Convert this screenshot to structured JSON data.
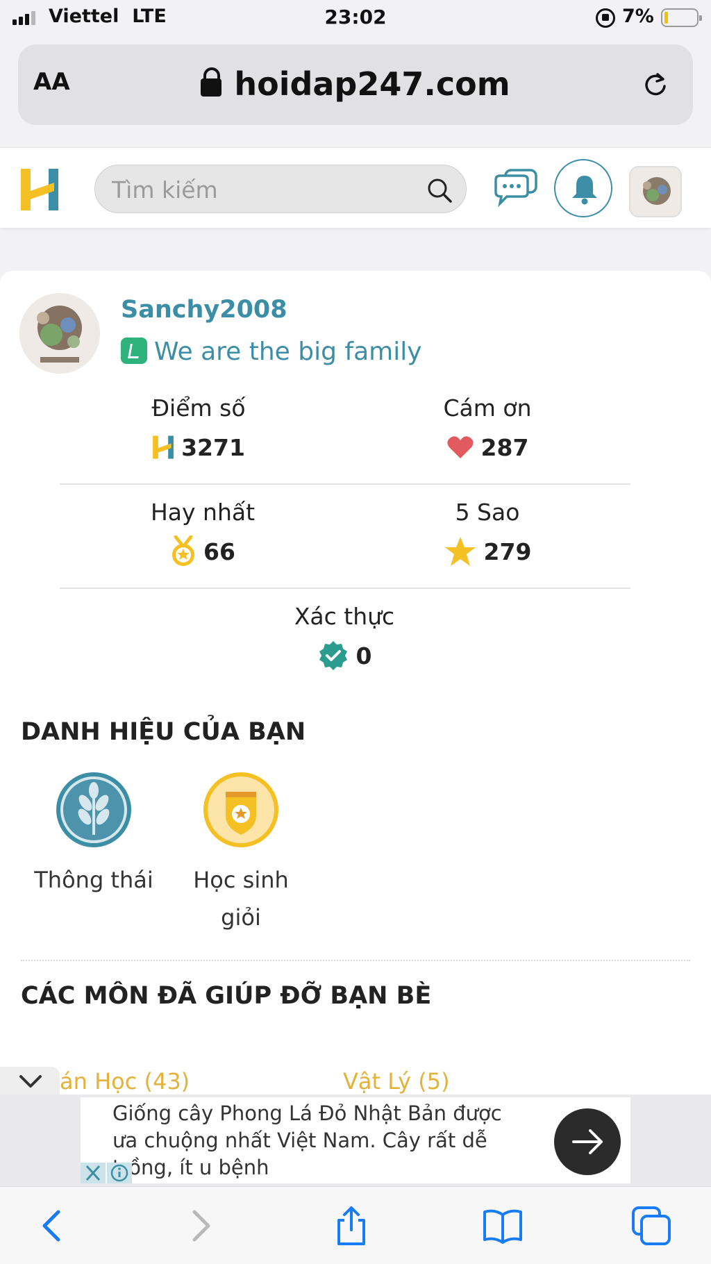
{
  "status_bar": {
    "carrier": "Viettel",
    "network": "LTE",
    "time": "23:02",
    "battery_percent": "7%",
    "battery_level": 0.07
  },
  "browser": {
    "aa_label": "AA",
    "domain": "hoidap247.com"
  },
  "header": {
    "logo_icon": "hoidap247-h-logo",
    "search_placeholder": "Tìm kiếm"
  },
  "profile": {
    "username": "Sanchy2008",
    "team": "We are the big family",
    "stats": {
      "diem_so": {
        "label": "Điểm số",
        "value": "3271",
        "icon": "h-logo-icon"
      },
      "cam_on": {
        "label": "Cám ơn",
        "value": "287",
        "icon": "heart-icon"
      },
      "hay_nhat": {
        "label": "Hay nhất",
        "value": "66",
        "icon": "medal-icon"
      },
      "nam_sao": {
        "label": "5 Sao",
        "value": "279",
        "icon": "star-icon"
      },
      "xac_thuc": {
        "label": "Xác thực",
        "value": "0",
        "icon": "verified-icon"
      }
    }
  },
  "titles_section": {
    "heading": "DANH HIỆU CỦA BẠN",
    "badges": [
      {
        "label": "Thông thái",
        "icon": "wheat-icon"
      },
      {
        "label": "Học sinh giỏi",
        "icon": "shield-star-icon"
      }
    ]
  },
  "subjects_section": {
    "heading": "CÁC MÔN ĐÃ GIÚP ĐỠ BẠN BÈ",
    "subjects": [
      "án Học (43)",
      "Vật Lý (5)"
    ]
  },
  "ad": {
    "text": "Giống cây Phong Lá Đỏ Nhật Bản được ưa chuộng nhất Việt Nam. Cây rất dễ trồng, ít u bệnh"
  },
  "colors": {
    "brand_teal": "#3b8ea5",
    "brand_yellow": "#f4c023",
    "subject_gold": "#e2b23a",
    "heart_red": "#e05a5f",
    "verified_green": "#2a9d8f"
  }
}
